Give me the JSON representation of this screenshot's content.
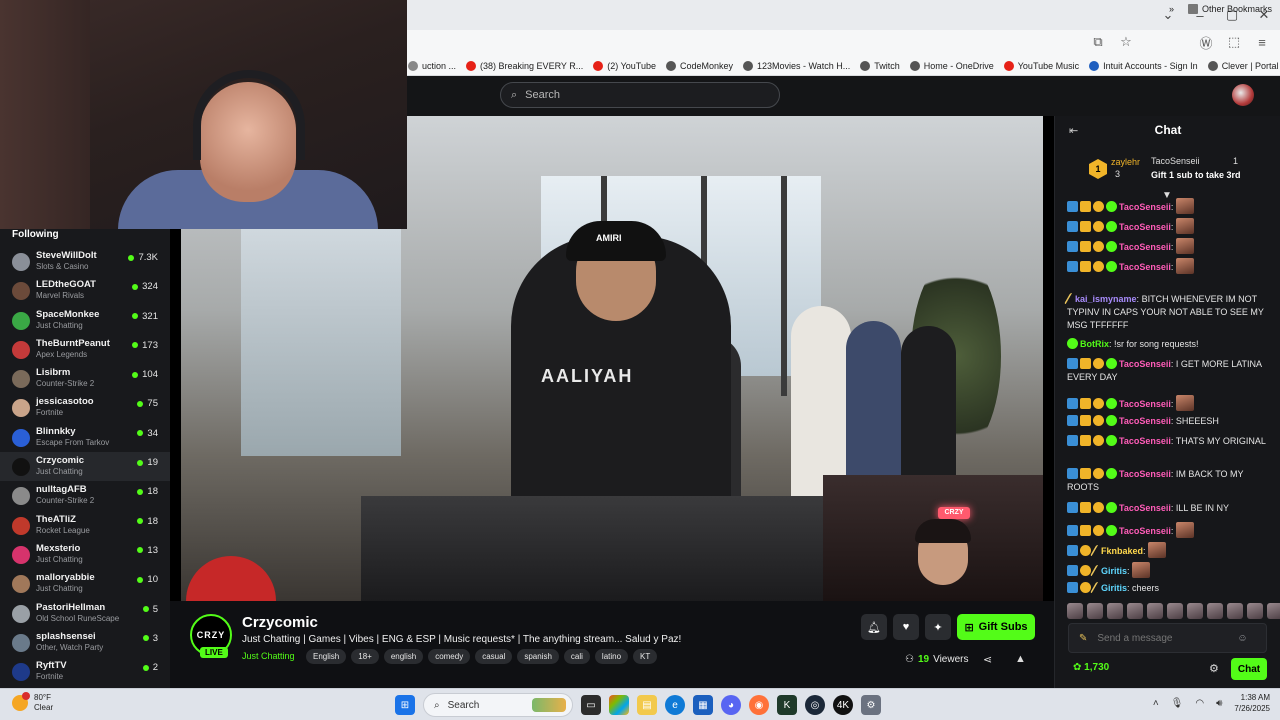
{
  "browser": {
    "window_controls": {
      "minimize": "–",
      "maximize": "▢",
      "close": "✕",
      "dropdown": "⌄"
    },
    "bookmarks": [
      {
        "label": "uction ...",
        "icon_color": "#888888"
      },
      {
        "label": "(38) Breaking EVERY R...",
        "icon_color": "#e62117"
      },
      {
        "label": "(2) YouTube",
        "icon_color": "#e62117"
      },
      {
        "label": "CodeMonkey",
        "icon_color": "#555555"
      },
      {
        "label": "123Movies - Watch H...",
        "icon_color": "#555555"
      },
      {
        "label": "Twitch",
        "icon_color": "#555555"
      },
      {
        "label": "Home - OneDrive",
        "icon_color": "#555555"
      },
      {
        "label": "YouTube Music",
        "icon_color": "#e62117"
      },
      {
        "label": "Intuit Accounts - Sign In",
        "icon_color": "#1f5fbf"
      },
      {
        "label": "Clever | Portal",
        "icon_color": "#555555"
      }
    ],
    "other_bookmarks": "Other Bookmarks"
  },
  "site": {
    "search_placeholder": "Search",
    "following_title": "Following",
    "sidebar": [
      {
        "name": "SteveWillDoIt",
        "game": "Slots & Casino",
        "viewers": "7.3K",
        "color": "#8a8f98"
      },
      {
        "name": "LEDtheGOAT",
        "game": "Marvel Rivals",
        "viewers": "324",
        "color": "#6b4a3a"
      },
      {
        "name": "SpaceMonkee",
        "game": "Just Chatting",
        "viewers": "321",
        "color": "#3aa845"
      },
      {
        "name": "TheBurntPeanut",
        "game": "Apex Legends",
        "viewers": "173",
        "color": "#c43a3a"
      },
      {
        "name": "Lisibrm",
        "game": "Counter-Strike 2",
        "viewers": "104",
        "color": "#7a6a5a"
      },
      {
        "name": "jessicasotoo",
        "game": "Fortnite",
        "viewers": "75",
        "color": "#c9a48a"
      },
      {
        "name": "Blinnkky",
        "game": "Escape From Tarkov",
        "viewers": "34",
        "color": "#2a5fd6"
      },
      {
        "name": "Crzycomic",
        "game": "Just Chatting",
        "viewers": "19",
        "color": "#111111"
      },
      {
        "name": "nulltagAFB",
        "game": "Counter-Strike 2",
        "viewers": "18",
        "color": "#8a8a8a"
      },
      {
        "name": "TheATliZ",
        "game": "Rocket League",
        "viewers": "18",
        "color": "#c0392b"
      },
      {
        "name": "Mexsterio",
        "game": "Just Chatting",
        "viewers": "13",
        "color": "#d6336c"
      },
      {
        "name": "malloryabbie",
        "game": "Just Chatting",
        "viewers": "10",
        "color": "#a0785a"
      },
      {
        "name": "PastoriHellman",
        "game": "Old School RuneScape",
        "viewers": "5",
        "color": "#9aa0a6"
      },
      {
        "name": "splashsensei",
        "game": "Other, Watch Party",
        "viewers": "3",
        "color": "#6a7a8a"
      },
      {
        "name": "RyftTV",
        "game": "Fortnite",
        "viewers": "2",
        "color": "#1e3a8a"
      }
    ]
  },
  "stream": {
    "channel_logo_text": "CRZY",
    "live_label": "LIVE",
    "channel_name": "Crzycomic",
    "title": "Just Chatting | Games | Vibes | ENG & ESP | Music requests* | The anything stream... Salud y Paz!",
    "category": "Just Chatting",
    "tags": [
      "English",
      "18+",
      "english",
      "comedy",
      "casual",
      "spanish",
      "cali",
      "latino",
      "KT"
    ],
    "gift_label": "Gift Subs",
    "viewer_count": "19",
    "viewers_label": "Viewers",
    "video_text": {
      "cap": "AMIRI",
      "shirt": "AALIYAH"
    },
    "pip_sign": "CRZY"
  },
  "chat": {
    "title": "Chat",
    "pinned": {
      "user1": "zaylehr",
      "num1": "3",
      "user2": "TacoSenseii",
      "num2": "1",
      "rank": "1",
      "gift_text": "Gift 1 sub to take 3rd"
    },
    "messages": [
      {
        "user": "TacoSenseii",
        "text": "",
        "emote": true
      },
      {
        "user": "TacoSenseii",
        "text": "",
        "emote": true
      },
      {
        "user": "TacoSenseii",
        "text": "",
        "emote": true
      },
      {
        "user": "TacoSenseii",
        "text": "",
        "emote": true
      },
      {
        "user": "kai_ismyname",
        "text": "BITCH WHENEVER IM NOT TYPINV IN CAPS YOUR NOT ABLE TO SEE MY MSG TFFFFFF",
        "emote": false
      },
      {
        "user": "BotRix",
        "text": "!sr for song requests!",
        "emote": false
      },
      {
        "user": "TacoSenseii",
        "text": "I GET MORE LATINA EVERY DAY",
        "emote": false
      },
      {
        "user": "TacoSenseii",
        "text": "",
        "emote": true
      },
      {
        "user": "TacoSenseii",
        "text": "SHEEESH",
        "emote": false
      },
      {
        "user": "TacoSenseii",
        "text": "THATS MY ORIGINAL",
        "emote": false
      },
      {
        "user": "TacoSenseii",
        "text": "IM BACK TO MY ROOTS",
        "emote": false
      },
      {
        "user": "TacoSenseii",
        "text": "ILL BE IN NY",
        "emote": false
      },
      {
        "user": "TacoSenseii",
        "text": "",
        "emote": true
      },
      {
        "user": "Fknbaked",
        "text": "",
        "emote": true
      },
      {
        "user": "Giritis",
        "text": "",
        "emote": true
      },
      {
        "user": "Giritis",
        "text": "cheers",
        "emote": false
      }
    ],
    "input_placeholder": "Send a message",
    "points": "1,730",
    "chat_button": "Chat"
  },
  "taskbar": {
    "temperature": "80°F",
    "condition": "Clear",
    "search_label": "Search",
    "time": "1:38 AM",
    "date": "7/26/2025"
  }
}
